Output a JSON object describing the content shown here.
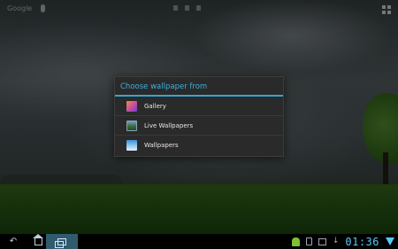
{
  "home_screen": {
    "search_label": "Google",
    "icons": [
      "mic-icon",
      "apps-grid-icon"
    ]
  },
  "dialog": {
    "title": "Choose wallpaper from",
    "options": [
      {
        "label": "Gallery",
        "icon": "gallery-icon"
      },
      {
        "label": "Live Wallpapers",
        "icon": "live-wallpapers-icon"
      },
      {
        "label": "Wallpapers",
        "icon": "wallpapers-icon"
      }
    ]
  },
  "navbar": {
    "buttons": [
      "back-icon",
      "home-icon",
      "recent-apps-icon"
    ],
    "tray_icons": [
      "android-icon",
      "usb-icon",
      "image-icon",
      "download-icon",
      "wifi-icon"
    ],
    "clock": "01:36"
  },
  "colors": {
    "accent": "#33a6d6",
    "dialog_bg": "#2a2a2a",
    "clock": "#58c8f0"
  }
}
